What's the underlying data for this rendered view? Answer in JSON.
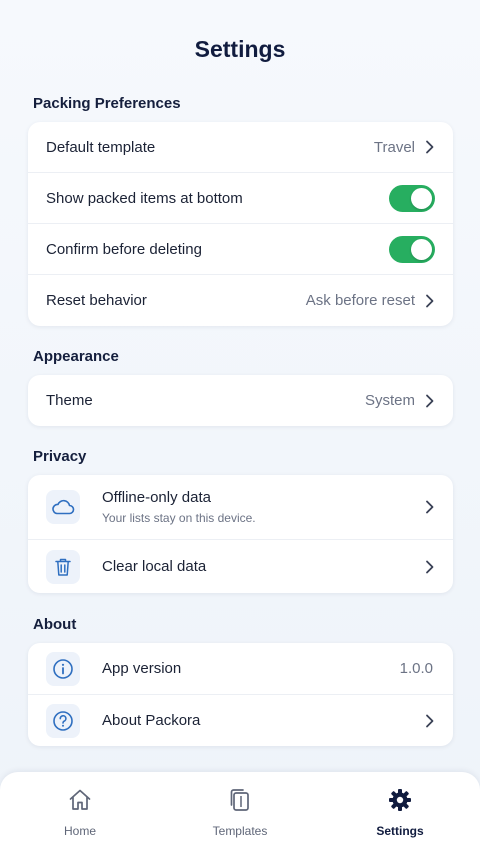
{
  "page": {
    "title": "Settings"
  },
  "sections": {
    "packing": {
      "title": "Packing Preferences",
      "rows": [
        {
          "label": "Default template",
          "value": "Travel"
        },
        {
          "label": "Show packed items at bottom",
          "toggle": true
        },
        {
          "label": "Confirm before deleting",
          "toggle": true
        },
        {
          "label": "Reset behavior",
          "value": "Ask before reset"
        }
      ]
    },
    "appearance": {
      "title": "Appearance",
      "rows": [
        {
          "label": "Theme",
          "value": "System"
        }
      ]
    },
    "privacy": {
      "title": "Privacy",
      "rows": [
        {
          "label": "Offline-only data",
          "sub": "Your lists stay on this device.",
          "icon": "cloud-icon"
        },
        {
          "label": "Clear local data",
          "icon": "trash-icon"
        }
      ]
    },
    "about": {
      "title": "About",
      "rows": [
        {
          "label": "App version",
          "value": "1.0.0",
          "icon": "info-icon"
        },
        {
          "label": "About Packora",
          "icon": "help-icon"
        }
      ]
    }
  },
  "tabbar": {
    "tabs": [
      {
        "label": "Home",
        "icon": "home-icon"
      },
      {
        "label": "Templates",
        "icon": "templates-icon"
      },
      {
        "label": "Settings",
        "icon": "gear-icon",
        "active": true
      }
    ]
  },
  "colors": {
    "accent": "#27ae60",
    "navy": "#111c3f",
    "icon_blue": "#2f6fc0"
  }
}
